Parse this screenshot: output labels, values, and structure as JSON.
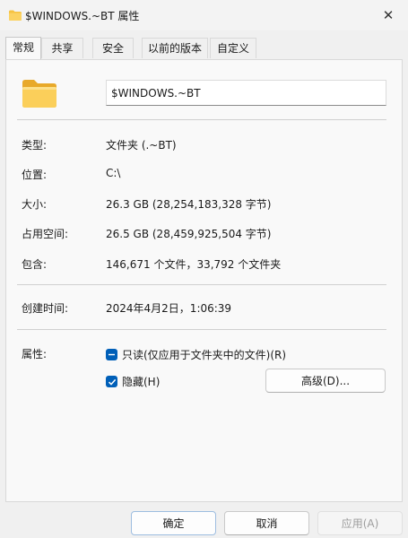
{
  "window": {
    "title": "$WINDOWS.~BT 属性",
    "close_glyph": "✕"
  },
  "tabs": [
    {
      "label": "常规",
      "active": true
    },
    {
      "label": "共享",
      "active": false
    },
    {
      "label": "安全",
      "active": false
    },
    {
      "label": "以前的版本",
      "active": false
    },
    {
      "label": "自定义",
      "active": false
    }
  ],
  "folder_name": "$WINDOWS.~BT",
  "properties": {
    "type": {
      "label": "类型:",
      "value": "文件夹 (.~BT)"
    },
    "location": {
      "label": "位置:",
      "value": "C:\\"
    },
    "size": {
      "label": "大小:",
      "value": "26.3 GB (28,254,183,328 字节)"
    },
    "size_on_disk": {
      "label": "占用空间:",
      "value": "26.5 GB (28,459,925,504 字节)"
    },
    "contains": {
      "label": "包含:",
      "value": "146,671 个文件，33,792 个文件夹"
    },
    "created": {
      "label": "创建时间:",
      "value": "2024年4月2日，1:06:39"
    }
  },
  "attributes": {
    "label": "属性:",
    "readonly": {
      "label": "只读(仅应用于文件夹中的文件)(R)",
      "state": "indeterminate"
    },
    "hidden": {
      "label": "隐藏(H)",
      "state": "checked"
    },
    "advanced_button": "高级(D)..."
  },
  "buttons": {
    "ok": "确定",
    "cancel": "取消",
    "apply": "应用(A)"
  },
  "colors": {
    "accent": "#005fb8",
    "folder": "#f6c342"
  }
}
